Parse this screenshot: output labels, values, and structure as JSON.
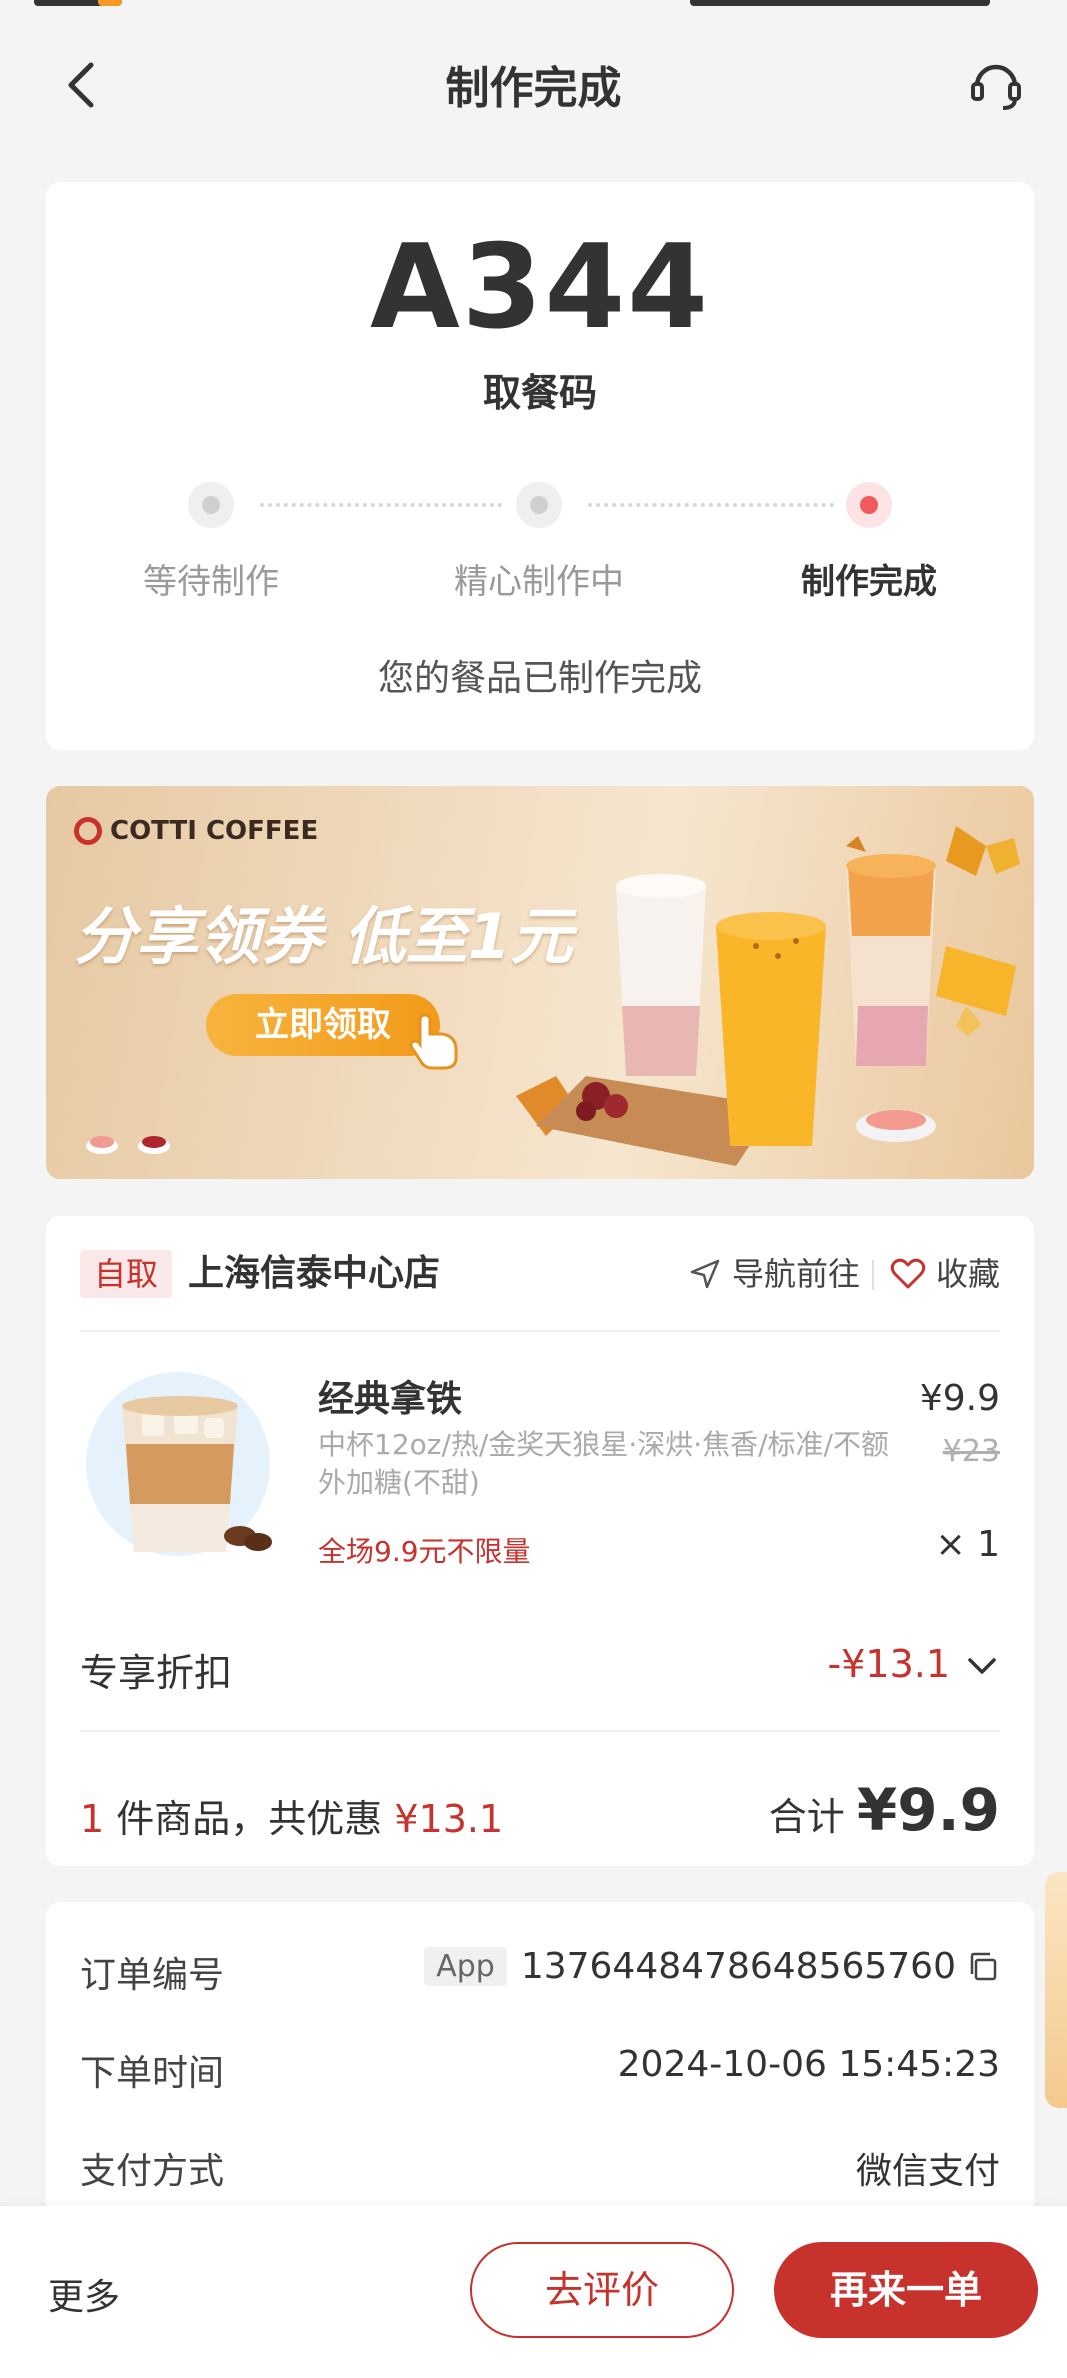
{
  "header": {
    "title": "制作完成"
  },
  "pickup": {
    "code": "A344",
    "code_label": "取餐码",
    "steps": [
      {
        "label": "等待制作",
        "active": false
      },
      {
        "label": "精心制作中",
        "active": false
      },
      {
        "label": "制作完成",
        "active": true
      }
    ],
    "message": "您的餐品已制作完成"
  },
  "banner": {
    "brand": "COTTI COFFEE",
    "title": "分享领券 低至1元",
    "button": "立即领取"
  },
  "order": {
    "pickup_tag": "自取",
    "store_name": "上海信泰中心店",
    "navigate_label": "导航前往",
    "favorite_label": "收藏",
    "product": {
      "name": "经典拿铁",
      "spec": "中杯12oz/热/金奖天狼星·深烘·焦香/标准/不额外加糖(不甜)",
      "promo": "全场9.9元不限量",
      "price": "¥9.9",
      "original_price": "¥23",
      "quantity": "× 1"
    },
    "discount_label": "专享折扣",
    "discount_value": "-¥13.1",
    "summary": {
      "count": "1",
      "count_suffix": "件商品，共优惠",
      "saved": "¥13.1",
      "total_label": "合计",
      "total": "¥9.9"
    }
  },
  "info": {
    "order_no_label": "订单编号",
    "order_source": "App",
    "order_no": "1376448478648565760",
    "time_label": "下单时间",
    "time": "2024-10-06 15:45:23",
    "payment_label": "支付方式",
    "payment": "微信支付"
  },
  "bottom_bar": {
    "more": "更多",
    "review": "去评价",
    "reorder": "再来一单"
  },
  "colors": {
    "accent": "#c8322d",
    "active_dot": "#f05a5a",
    "background": "#f4f4f4"
  }
}
